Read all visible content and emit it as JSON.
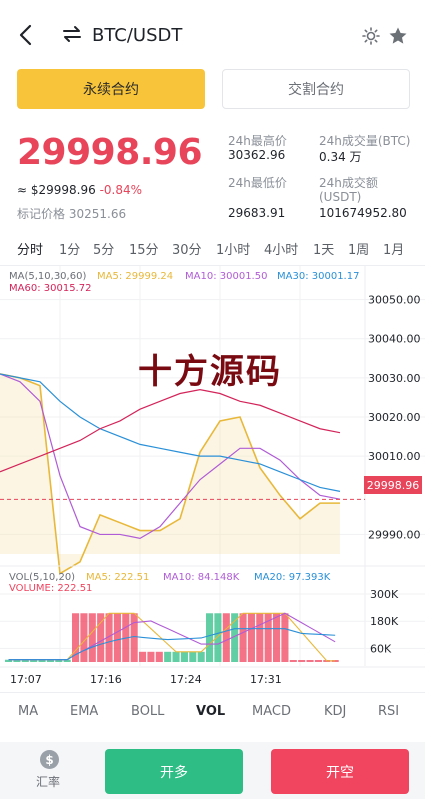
{
  "header": {
    "pair": "BTC/USDT",
    "icons": {
      "back": "back-arrow-icon",
      "swap": "swap-icon",
      "theme": "sun-icon",
      "favorite": "star-icon"
    }
  },
  "contract_tabs": [
    {
      "label": "永续合约",
      "active": true
    },
    {
      "label": "交割合约",
      "active": false
    }
  ],
  "price": {
    "last": "29998.96",
    "approx_prefix": "≈ $29998.96",
    "change": "-0.84%",
    "mark_label": "标记价格",
    "mark_value": "30251.66"
  },
  "stats": {
    "high_label": "24h最高价",
    "high_value": "30362.96",
    "low_label": "24h最低价",
    "low_value": "29683.91",
    "vol_btc_label": "24h成交量(BTC)",
    "vol_btc_value": "0.34 万",
    "vol_usdt_label": "24h成交额",
    "vol_usdt_label2": "(USDT)",
    "vol_usdt_value": "101674952.80"
  },
  "intervals": [
    "分时",
    "1分",
    "5分",
    "15分",
    "30分",
    "1小时",
    "4小时",
    "1天",
    "1周",
    "1月"
  ],
  "active_interval": "分时",
  "chart_legend": {
    "ma_title": "MA(5,10,30,60)",
    "ma5": "MA5: 29999.24",
    "ma10": "MA10: 30001.50",
    "ma30": "MA30: 30001.17",
    "ma60": "MA60: 30015.72",
    "vol_title": "VOL(5,10,20)",
    "vol_ma5": "MA5: 222.51",
    "vol_ma10": "MA10: 84.148K",
    "vol_ma20": "MA20: 97.393K",
    "volume": "VOLUME: 222.51"
  },
  "colors": {
    "up": "#2ebd85",
    "down": "#f0445f",
    "ma5": "#e8b83a",
    "ma10": "#b05cd6",
    "ma30": "#2a90d8",
    "ma60": "#d4245a",
    "accent": "#f8c43a"
  },
  "watermark": "十方源码",
  "current_price_tag": "29998.96",
  "chart_data": [
    {
      "type": "line",
      "title": "",
      "y_ticks": [
        "30050.00",
        "30040.00",
        "30030.00",
        "30020.00",
        "30010.00",
        "29990.00"
      ],
      "ylim": [
        29985,
        30055
      ],
      "x_ticks": [
        "17:07",
        "17:16",
        "17:24",
        "17:31"
      ],
      "current_price": 29998.96,
      "series": [
        {
          "name": "MA5",
          "values": [
            30031,
            30030,
            30028,
            29980,
            29983,
            29995,
            29993,
            29991,
            29991,
            29994,
            30011,
            30019,
            30020,
            30007,
            30000,
            29994,
            29998,
            29998
          ]
        },
        {
          "name": "MA10",
          "values": [
            30031,
            30029,
            30024,
            30005,
            29992,
            29990,
            29990,
            29989,
            29992,
            29998,
            30004,
            30008,
            30012,
            30012,
            30009,
            30004,
            30000,
            29999
          ]
        },
        {
          "name": "MA30",
          "values": [
            30031,
            30030,
            30029,
            30024,
            30020,
            30017,
            30015,
            30013,
            30012,
            30011,
            30010,
            30010,
            30009,
            30008,
            30006,
            30004,
            30002,
            30001
          ]
        },
        {
          "name": "MA60",
          "values": [
            30006,
            30008,
            30010,
            30012,
            30014,
            30017,
            30019,
            30022,
            30024,
            30026,
            30027,
            30026,
            30024,
            30023,
            30021,
            30019,
            30017,
            30016
          ]
        }
      ]
    },
    {
      "type": "bar",
      "title": "",
      "y_ticks": [
        "300K",
        "180K",
        "60K"
      ],
      "ylim": [
        0,
        300000
      ],
      "bars": [
        {
          "dir": "up",
          "value": 10000
        },
        {
          "dir": "up",
          "value": 10000
        },
        {
          "dir": "up",
          "value": 10000
        },
        {
          "dir": "up",
          "value": 10000
        },
        {
          "dir": "up",
          "value": 10000
        },
        {
          "dir": "up",
          "value": 10000
        },
        {
          "dir": "up",
          "value": 10000
        },
        {
          "dir": "up",
          "value": 10000
        },
        {
          "dir": "down",
          "value": 215000
        },
        {
          "dir": "down",
          "value": 215000
        },
        {
          "dir": "down",
          "value": 215000
        },
        {
          "dir": "down",
          "value": 215000
        },
        {
          "dir": "down",
          "value": 215000
        },
        {
          "dir": "down",
          "value": 215000
        },
        {
          "dir": "down",
          "value": 215000
        },
        {
          "dir": "down",
          "value": 215000
        },
        {
          "dir": "down",
          "value": 45000
        },
        {
          "dir": "down",
          "value": 45000
        },
        {
          "dir": "down",
          "value": 45000
        },
        {
          "dir": "up",
          "value": 45000
        },
        {
          "dir": "up",
          "value": 45000
        },
        {
          "dir": "up",
          "value": 45000
        },
        {
          "dir": "up",
          "value": 45000
        },
        {
          "dir": "up",
          "value": 45000
        },
        {
          "dir": "up",
          "value": 215000
        },
        {
          "dir": "up",
          "value": 215000
        },
        {
          "dir": "down",
          "value": 215000
        },
        {
          "dir": "up",
          "value": 215000
        },
        {
          "dir": "down",
          "value": 215000
        },
        {
          "dir": "down",
          "value": 215000
        },
        {
          "dir": "down",
          "value": 215000
        },
        {
          "dir": "down",
          "value": 215000
        },
        {
          "dir": "down",
          "value": 215000
        },
        {
          "dir": "down",
          "value": 215000
        },
        {
          "dir": "down",
          "value": 5000
        },
        {
          "dir": "down",
          "value": 5000
        },
        {
          "dir": "down",
          "value": 5000
        },
        {
          "dir": "down",
          "value": 5000
        },
        {
          "dir": "down",
          "value": 5000
        },
        {
          "dir": "down",
          "value": 5000
        }
      ]
    }
  ],
  "indicators": [
    "MA",
    "EMA",
    "BOLL",
    "VOL",
    "MACD",
    "KDJ",
    "RSI"
  ],
  "active_indicator": "VOL",
  "bottom": {
    "rate_symbol": "$",
    "rate_label": "汇率",
    "long_label": "开多",
    "short_label": "开空"
  }
}
